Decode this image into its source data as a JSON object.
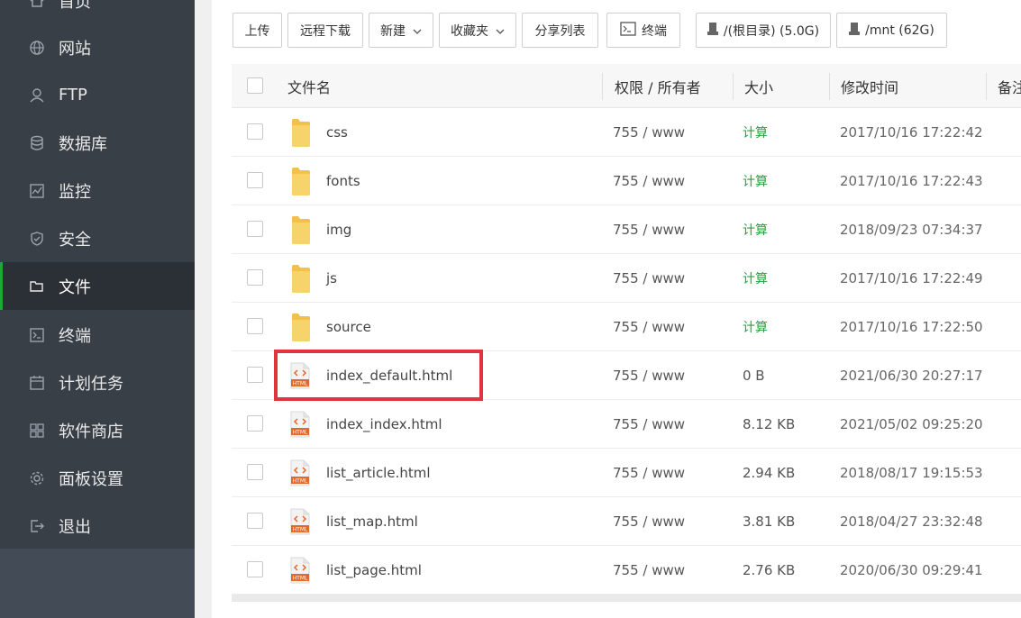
{
  "sidebar": {
    "items": [
      {
        "label": "首页",
        "icon": "home-icon"
      },
      {
        "label": "网站",
        "icon": "globe-icon"
      },
      {
        "label": "FTP",
        "icon": "ftp-icon"
      },
      {
        "label": "数据库",
        "icon": "database-icon"
      },
      {
        "label": "监控",
        "icon": "monitor-icon"
      },
      {
        "label": "安全",
        "icon": "shield-icon"
      },
      {
        "label": "文件",
        "icon": "folder-icon"
      },
      {
        "label": "终端",
        "icon": "terminal-icon"
      },
      {
        "label": "计划任务",
        "icon": "calendar-icon"
      },
      {
        "label": "软件商店",
        "icon": "grid-icon"
      },
      {
        "label": "面板设置",
        "icon": "gear-icon"
      },
      {
        "label": "退出",
        "icon": "logout-icon"
      }
    ],
    "active": "文件"
  },
  "toolbar": {
    "upload": "上传",
    "remote_download": "远程下载",
    "new": "新建",
    "favorites": "收藏夹",
    "share_list": "分享列表",
    "terminal": "终端",
    "disk_root": "/(根目录) (5.0G)",
    "disk_mnt": "/mnt (62G)"
  },
  "table": {
    "headers": {
      "name": "文件名",
      "perm": "权限 / 所有者",
      "size": "大小",
      "mtime": "修改时间",
      "note": "备注"
    },
    "rows": [
      {
        "type": "folder",
        "name": "css",
        "perm": "755 / www",
        "size": "计算",
        "mtime": "2017/10/16 17:22:42"
      },
      {
        "type": "folder",
        "name": "fonts",
        "perm": "755 / www",
        "size": "计算",
        "mtime": "2017/10/16 17:22:43"
      },
      {
        "type": "folder",
        "name": "img",
        "perm": "755 / www",
        "size": "计算",
        "mtime": "2018/09/23 07:34:37"
      },
      {
        "type": "folder",
        "name": "js",
        "perm": "755 / www",
        "size": "计算",
        "mtime": "2017/10/16 17:22:49"
      },
      {
        "type": "folder",
        "name": "source",
        "perm": "755 / www",
        "size": "计算",
        "mtime": "2017/10/16 17:22:50"
      },
      {
        "type": "html",
        "name": "index_default.html",
        "perm": "755 / www",
        "size": "0 B",
        "mtime": "2021/06/30 20:27:17"
      },
      {
        "type": "html",
        "name": "index_index.html",
        "perm": "755 / www",
        "size": "8.12 KB",
        "mtime": "2021/05/02 09:25:20"
      },
      {
        "type": "html",
        "name": "list_article.html",
        "perm": "755 / www",
        "size": "2.94 KB",
        "mtime": "2018/08/17 19:15:53"
      },
      {
        "type": "html",
        "name": "list_map.html",
        "perm": "755 / www",
        "size": "3.81 KB",
        "mtime": "2018/04/27 23:32:48"
      },
      {
        "type": "html",
        "name": "list_page.html",
        "perm": "755 / www",
        "size": "2.76 KB",
        "mtime": "2020/06/30 09:29:41"
      }
    ]
  },
  "file_icon_label": "HTML",
  "colors": {
    "accent": "#20a53a",
    "highlight": "#e0353a",
    "sidebar_bg": "#383f47",
    "folder": "#f6c342"
  }
}
